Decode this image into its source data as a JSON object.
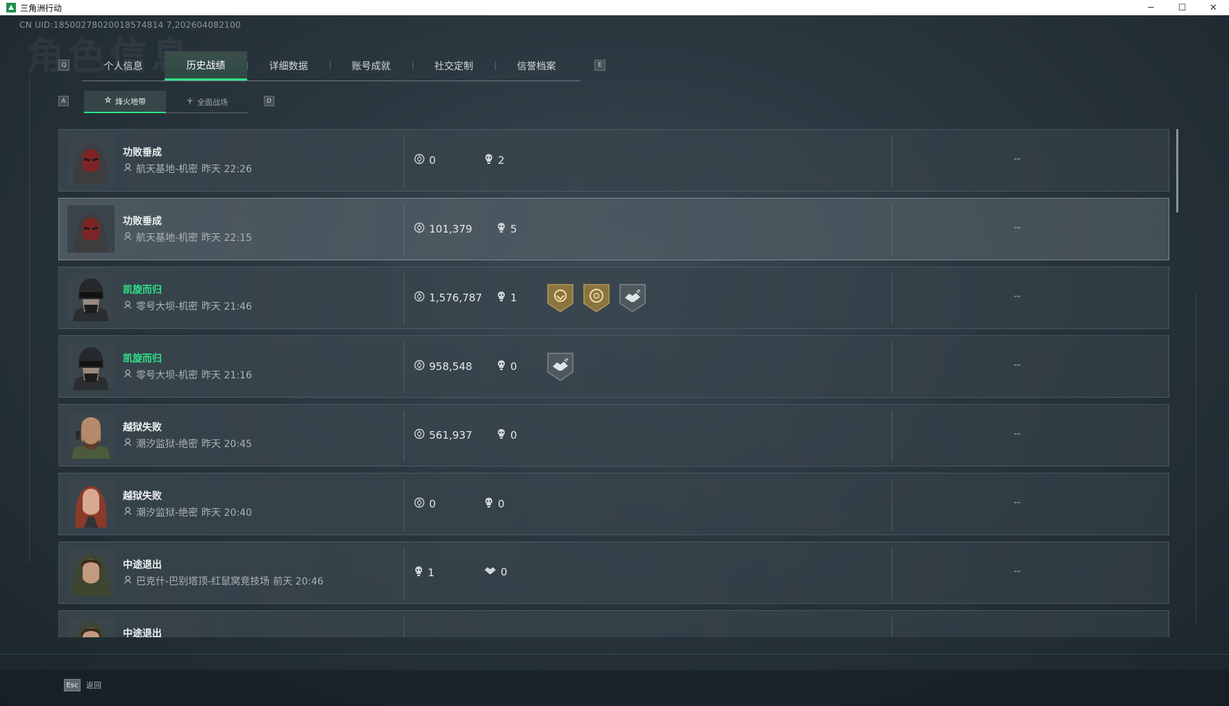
{
  "window": {
    "title": "三角洲行动",
    "controls": [
      "─",
      "☐",
      "✕"
    ]
  },
  "uid": "CN UID:18500278020018574814 7,202604082100",
  "watermark": "角色信息",
  "tabs": {
    "prev_key": "Q",
    "next_key": "E",
    "items": [
      {
        "label": "个人信息"
      },
      {
        "label": "历史战绩",
        "active": true
      },
      {
        "label": "详细数据"
      },
      {
        "label": "账号成就"
      },
      {
        "label": "社交定制"
      },
      {
        "label": "信誉档案"
      }
    ]
  },
  "subtabs": {
    "prev_key": "A",
    "next_key": "D",
    "items": [
      {
        "label": "烽火地带",
        "active": true
      },
      {
        "label": "全面战场"
      }
    ]
  },
  "matches": [
    {
      "result": "功败垂成",
      "win": false,
      "map": "航天基地-机密",
      "time": "昨天 22:26",
      "stat1_icon": "coin-icon",
      "stat1": "0",
      "stat2_icon": "kill-icon",
      "stat2": "2",
      "badges": [],
      "extra": "--",
      "avatar": "hooded-red"
    },
    {
      "result": "功败垂成",
      "win": false,
      "map": "航天基地-机密",
      "time": "昨天 22:15",
      "stat1_icon": "coin-icon",
      "stat1": "101,379",
      "stat2_icon": "kill-icon",
      "stat2": "5",
      "badges": [],
      "extra": "--",
      "avatar": "hooded-red",
      "highlight": true
    },
    {
      "result": "凯旋而归",
      "win": true,
      "map": "零号大坝-机密",
      "time": "昨天 21:46",
      "stat1_icon": "coin-icon",
      "stat1": "1,576,787",
      "stat2_icon": "kill-icon",
      "stat2": "1",
      "badges": [
        "gold-shield-badge",
        "gold-coin-badge",
        "grey-assist-badge"
      ],
      "extra": "--",
      "avatar": "helmet"
    },
    {
      "result": "凯旋而归",
      "win": true,
      "map": "零号大坝-机密",
      "time": "昨天 21:16",
      "stat1_icon": "coin-icon",
      "stat1": "958,548",
      "stat2_icon": "kill-icon",
      "stat2": "0",
      "badges": [
        "grey-assist-badge"
      ],
      "extra": "--",
      "avatar": "helmet"
    },
    {
      "result": "越狱失败",
      "win": false,
      "map": "潮汐监狱-绝密",
      "time": "昨天 20:45",
      "stat1_icon": "coin-icon",
      "stat1": "561,937",
      "stat2_icon": "kill-icon",
      "stat2": "0",
      "badges": [],
      "extra": "--",
      "avatar": "bearded"
    },
    {
      "result": "越狱失败",
      "win": false,
      "map": "潮汐监狱-绝密",
      "time": "昨天 20:40",
      "stat1_icon": "coin-icon",
      "stat1": "0",
      "stat2_icon": "kill-icon",
      "stat2": "0",
      "badges": [],
      "extra": "--",
      "avatar": "redhair"
    },
    {
      "result": "中途退出",
      "win": false,
      "map": "巴克什-巴别塔顶-红鼠窝竞技场",
      "time": "前天 20:46",
      "stat1_icon": "kill-icon",
      "stat1": "1",
      "stat2_icon": "handshake-icon",
      "stat2": "0",
      "badges": [],
      "extra": "--",
      "avatar": "hooded-woman"
    },
    {
      "result": "中途退出",
      "win": false,
      "map": "",
      "time": "",
      "stat1_icon": "coin-icon",
      "stat1": "",
      "stat2_icon": "kill-icon",
      "stat2": "",
      "badges": [],
      "extra": "",
      "avatar": "hooded-woman"
    }
  ],
  "footer": {
    "esc_key": "Esc",
    "esc_label": "返回"
  }
}
